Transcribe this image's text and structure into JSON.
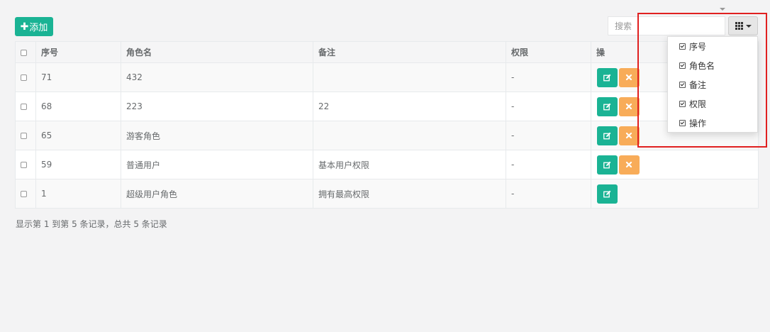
{
  "toolbar": {
    "add_plus": "✚",
    "add_label": "添加",
    "search_placeholder": "搜索",
    "columns_icon": "grid-icon"
  },
  "table": {
    "headers": [
      "序号",
      "角色名",
      "备注",
      "权限",
      "操"
    ],
    "rows": [
      {
        "id": "71",
        "name": "432",
        "remark": "",
        "perm": "-",
        "delete": true
      },
      {
        "id": "68",
        "name": "223",
        "remark": "22",
        "perm": "-",
        "delete": true
      },
      {
        "id": "65",
        "name": "游客角色",
        "remark": "",
        "perm": "-",
        "delete": true
      },
      {
        "id": "59",
        "name": "普通用户",
        "remark": "基本用户权限",
        "perm": "-",
        "delete": true
      },
      {
        "id": "1",
        "name": "超级用户角色",
        "remark": "拥有最高权限",
        "perm": "-",
        "delete": false
      }
    ]
  },
  "pagination": {
    "summary": "显示第 1 到第 5 条记录，总共 5 条记录"
  },
  "column_menu": {
    "items": [
      {
        "label": "序号",
        "checked": true
      },
      {
        "label": "角色名",
        "checked": true
      },
      {
        "label": "备注",
        "checked": true
      },
      {
        "label": "权限",
        "checked": true
      },
      {
        "label": "操作",
        "checked": true
      }
    ]
  },
  "colors": {
    "primary": "#1ab394",
    "warning": "#f8ac59",
    "highlight": "#e02020"
  }
}
